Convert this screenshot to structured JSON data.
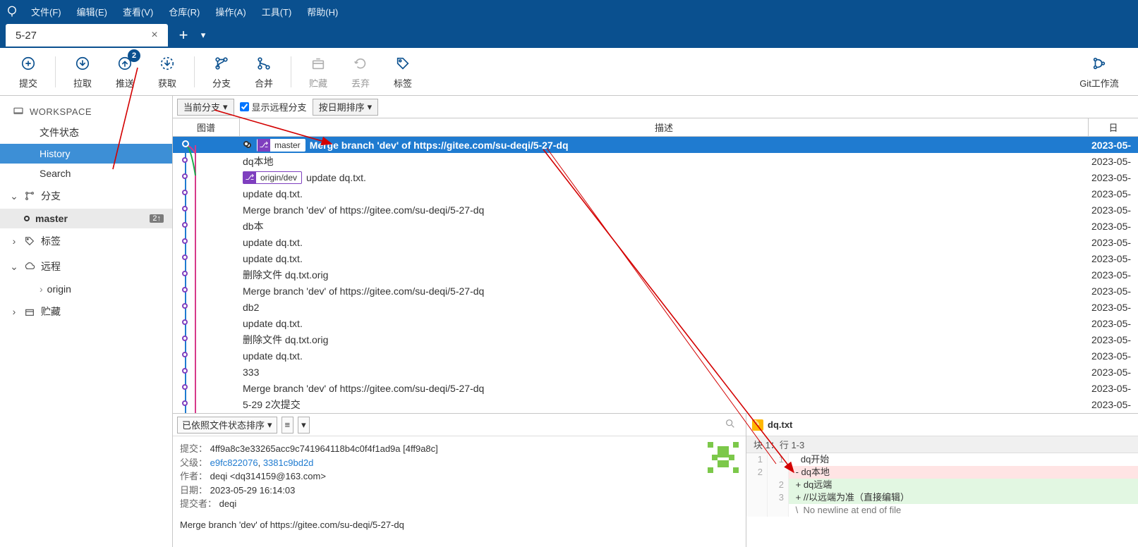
{
  "menu": [
    "文件(F)",
    "编辑(E)",
    "查看(V)",
    "仓库(R)",
    "操作(A)",
    "工具(T)",
    "帮助(H)"
  ],
  "tab": {
    "title": "5-27"
  },
  "toolbar": {
    "commit": "提交",
    "pull": "拉取",
    "push": "推送",
    "push_badge": "2",
    "fetch": "获取",
    "branch": "分支",
    "merge": "合并",
    "stash": "贮藏",
    "discard": "丢弃",
    "tag": "标签",
    "gitflow": "Git工作流"
  },
  "sidebar": {
    "workspace": "WORKSPACE",
    "file_status": "文件状态",
    "history": "History",
    "search": "Search",
    "branches": "分支",
    "master": "master",
    "master_badge": "2↑",
    "tags": "标签",
    "remotes": "远程",
    "origin": "origin",
    "stashes": "贮藏"
  },
  "filter": {
    "current_branch": "当前分支",
    "show_remote": "显示远程分支",
    "sort_date": "按日期排序"
  },
  "history_head": {
    "graph": "图谱",
    "desc": "描述",
    "date": "日"
  },
  "commits": [
    {
      "selected": true,
      "tags": [
        {
          "icon": "b",
          "text": "master"
        }
      ],
      "desc": "Merge branch 'dev' of https://gitee.com/su-deqi/5-27-dq",
      "date": "2023-05-"
    },
    {
      "desc": "dq本地",
      "date": "2023-05-"
    },
    {
      "tags": [
        {
          "icon": "b",
          "text": "origin/dev"
        }
      ],
      "desc": "update dq.txt.",
      "date": "2023-05-"
    },
    {
      "desc": "update dq.txt.",
      "date": "2023-05-"
    },
    {
      "desc": "Merge branch 'dev' of https://gitee.com/su-deqi/5-27-dq",
      "date": "2023-05-"
    },
    {
      "desc": "db本",
      "date": "2023-05-"
    },
    {
      "desc": "update dq.txt.",
      "date": "2023-05-"
    },
    {
      "desc": "update dq.txt.",
      "date": "2023-05-"
    },
    {
      "desc": "删除文件 dq.txt.orig",
      "date": "2023-05-"
    },
    {
      "desc": "Merge branch 'dev' of https://gitee.com/su-deqi/5-27-dq",
      "date": "2023-05-"
    },
    {
      "desc": "db2",
      "date": "2023-05-"
    },
    {
      "desc": "update dq.txt.",
      "date": "2023-05-"
    },
    {
      "desc": "删除文件 dq.txt.orig",
      "date": "2023-05-"
    },
    {
      "desc": "update dq.txt.",
      "date": "2023-05-"
    },
    {
      "desc": "333",
      "date": "2023-05-"
    },
    {
      "desc": "Merge branch 'dev' of https://gitee.com/su-deqi/5-27-dq",
      "date": "2023-05-"
    },
    {
      "desc": "5-29 2次提交",
      "date": "2023-05-"
    }
  ],
  "detail_bar": {
    "sort": "已依照文件状态排序"
  },
  "commit_info": {
    "commit_lbl": "提交：",
    "commit_val": "4ff9a8c3e33265acc9c741964118b4c0f4f1ad9a [4ff9a8c]",
    "parent_lbl": "父级：",
    "parent_val_1": "e9fc822076",
    "parent_val_2": "3381c9bd2d",
    "author_lbl": "作者：",
    "author_val": "deqi <dq314159@163.com>",
    "date_lbl": "日期：",
    "date_val": "2023-05-29 16:14:03",
    "committer_lbl": "提交者：",
    "committer_val": "deqi",
    "message": "Merge branch 'dev' of https://gitee.com/su-deqi/5-27-dq"
  },
  "diff": {
    "file": "dq.txt",
    "hunk": "块 1：行 1-3",
    "lines": [
      {
        "type": "ctx",
        "a": "1",
        "b": "1",
        "text": "   dq开始"
      },
      {
        "type": "del",
        "a": "2",
        "b": "",
        "text": " - dq本地"
      },
      {
        "type": "add",
        "a": "",
        "b": "2",
        "text": " + dq远端"
      },
      {
        "type": "add",
        "a": "",
        "b": "3",
        "text": " + //以远端为准（直接编辑）"
      },
      {
        "type": "meta",
        "a": "",
        "b": "",
        "text": " \\  No newline at end of file"
      }
    ]
  }
}
